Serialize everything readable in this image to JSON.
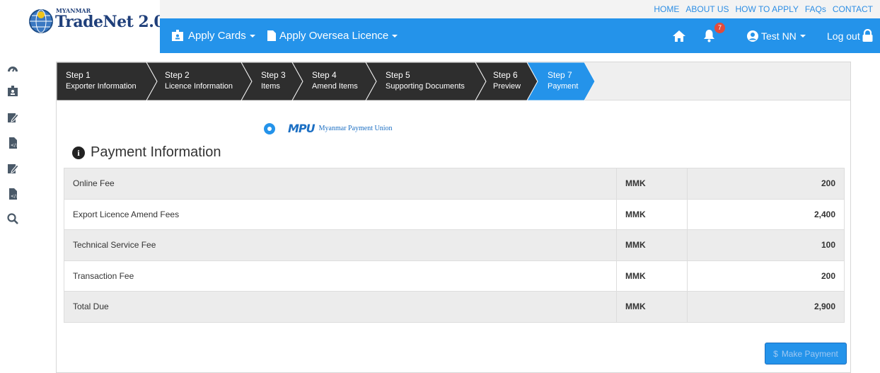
{
  "brand": {
    "logo_small": "MYANMAR",
    "logo_main": "TradeNet 2.0"
  },
  "top_links": [
    "HOME",
    "ABOUT US",
    "HOW TO APPLY",
    "FAQs",
    "CONTACT"
  ],
  "nav": {
    "apply_cards": "Apply Cards",
    "apply_oversea": "Apply Oversea Licence",
    "notifications_count": "7",
    "user": "Test NN",
    "logout": "Log out"
  },
  "sidebar_icons": [
    "dashboard-icon",
    "id-card-icon",
    "edit-icon",
    "file-code-icon",
    "edit-icon",
    "file-code-icon",
    "search-icon"
  ],
  "steps": [
    {
      "num": "Step 1",
      "label": "Exporter Information",
      "active": false
    },
    {
      "num": "Step 2",
      "label": "Licence Information",
      "active": false
    },
    {
      "num": "Step 3",
      "label": "Items",
      "active": false
    },
    {
      "num": "Step 4",
      "label": "Amend Items",
      "active": false
    },
    {
      "num": "Step 5",
      "label": "Supporting Documents",
      "active": false
    },
    {
      "num": "Step 6",
      "label": "Preview",
      "active": false
    },
    {
      "num": "Step 7",
      "label": "Payment",
      "active": true
    }
  ],
  "payment": {
    "method_logo": "MPU",
    "method_name": "Myanmar Payment Union",
    "title": "Payment Information",
    "rows": [
      {
        "label": "Online Fee",
        "currency": "MMK",
        "amount": "200"
      },
      {
        "label": "Export Licence Amend Fees",
        "currency": "MMK",
        "amount": "2,400"
      },
      {
        "label": "Technical Service Fee",
        "currency": "MMK",
        "amount": "100"
      },
      {
        "label": "Transaction Fee",
        "currency": "MMK",
        "amount": "200"
      },
      {
        "label": "Total Due",
        "currency": "MMK",
        "amount": "2,900"
      }
    ],
    "button_icon": "$",
    "button_label": "Make Payment"
  },
  "colors": {
    "primary": "#2493ea",
    "step_dark": "#333333",
    "step_active": "#2493ea"
  }
}
